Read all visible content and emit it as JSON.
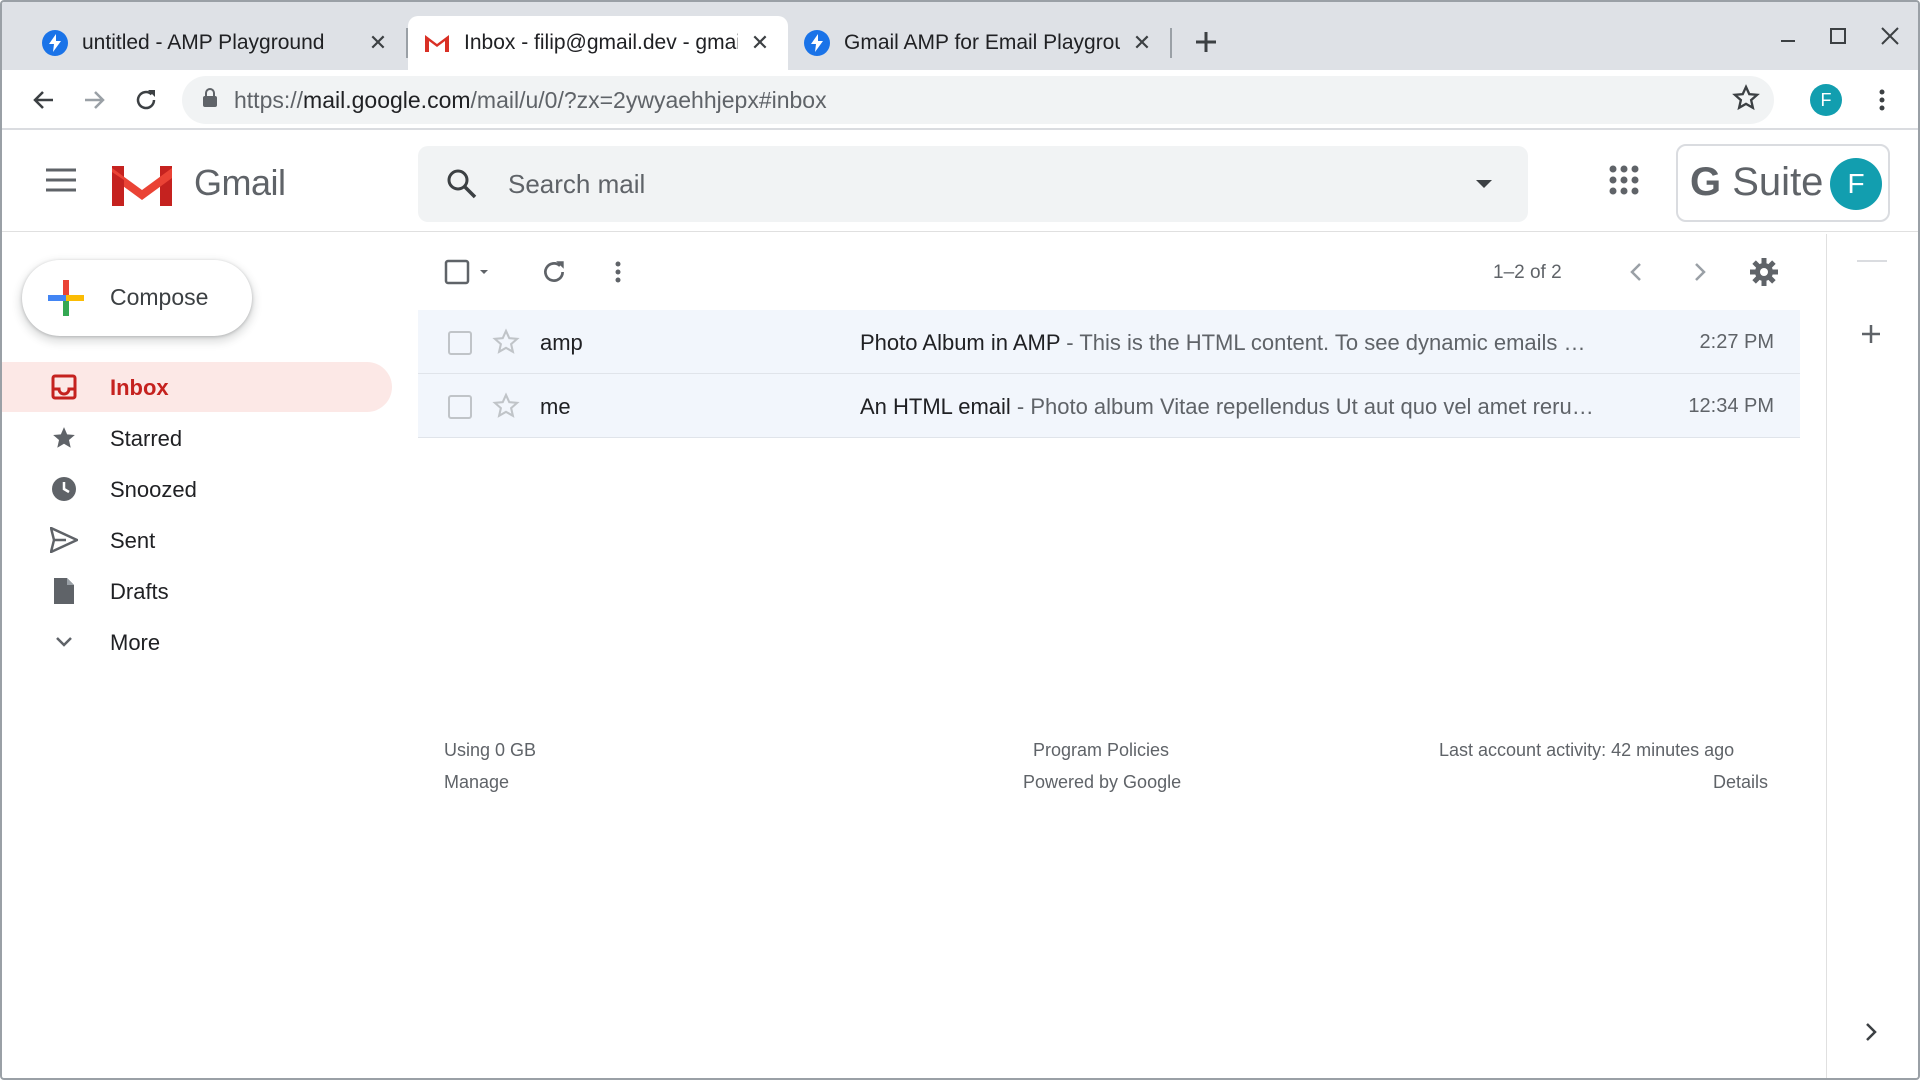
{
  "browser": {
    "tabs": [
      {
        "title": "untitled - AMP Playground",
        "icon": "amp-bolt-icon",
        "active": false
      },
      {
        "title": "Inbox - filip@gmail.dev - gmail",
        "icon": "gmail-icon",
        "active": true
      },
      {
        "title": "Gmail AMP for Email Playground",
        "icon": "amp-bolt-icon",
        "active": false
      }
    ],
    "new_tab_icon": "plus-icon",
    "url": {
      "scheme": "https://",
      "host": "mail.google.com",
      "path": "/mail/u/0/?zx=2ywyaehhjepx#inbox"
    },
    "profile_initial": "F"
  },
  "gmail": {
    "logo_text": "Gmail",
    "search_placeholder": "Search mail",
    "gsuite_label": "Suite",
    "gsuite_g": "G",
    "avatar_initial": "F",
    "compose_label": "Compose",
    "nav": [
      {
        "label": "Inbox",
        "icon": "inbox-icon",
        "active": true
      },
      {
        "label": "Starred",
        "icon": "star-icon",
        "active": false
      },
      {
        "label": "Snoozed",
        "icon": "clock-icon",
        "active": false
      },
      {
        "label": "Sent",
        "icon": "send-icon",
        "active": false
      },
      {
        "label": "Drafts",
        "icon": "draft-icon",
        "active": false
      },
      {
        "label": "More",
        "icon": "chevron-down-icon",
        "active": false
      }
    ],
    "pagination": "1–2 of 2",
    "emails": [
      {
        "sender": "amp",
        "subject": "Photo Album in AMP",
        "snippet": " - This is the HTML content. To see dynamic emails …",
        "time": "2:27 PM"
      },
      {
        "sender": "me",
        "subject": "An HTML email",
        "snippet": " - Photo album Vitae repellendus Ut aut quo vel amet reru…",
        "time": "12:34 PM"
      }
    ],
    "footer": {
      "storage": "Using 0 GB",
      "manage": "Manage",
      "policies": "Program Policies",
      "powered": "Powered by Google",
      "activity": "Last account activity: 42 minutes ago",
      "details": "Details"
    }
  },
  "colors": {
    "accent_red": "#c5221f",
    "active_bg": "#fce8e6",
    "avatar_teal": "#129eaf",
    "amp_blue": "#1a73e8"
  }
}
